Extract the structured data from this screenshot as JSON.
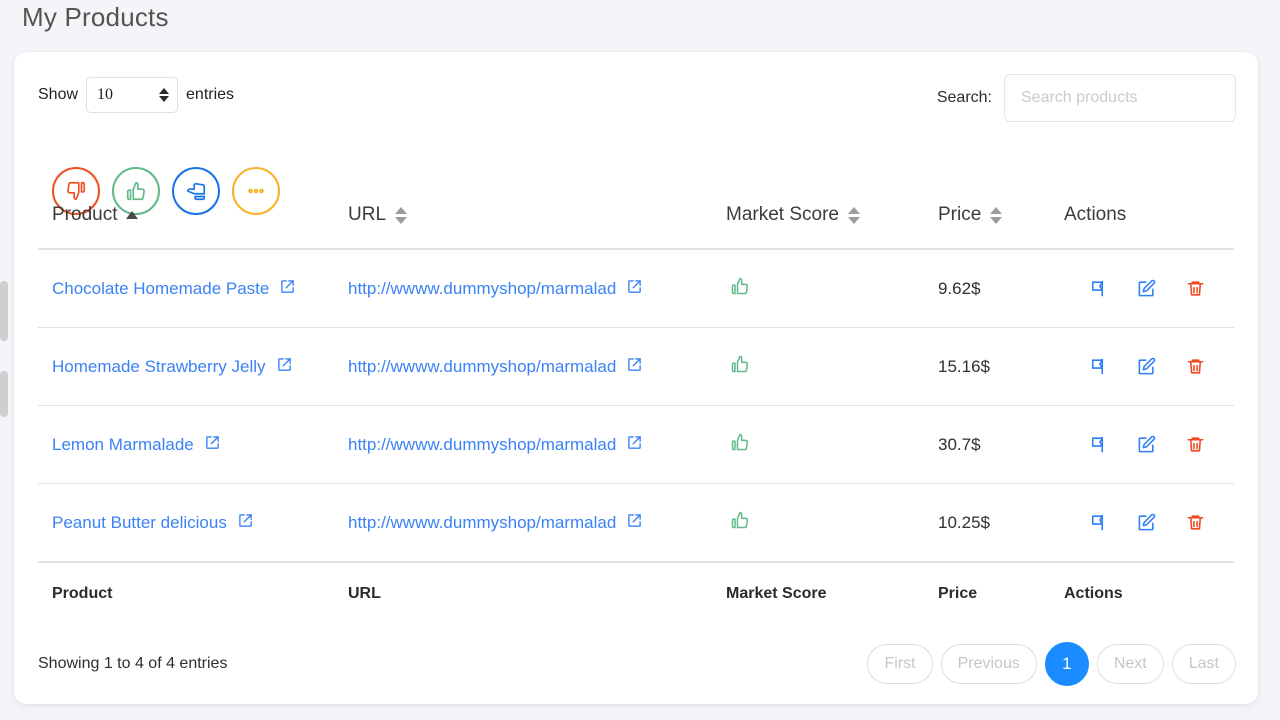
{
  "page": {
    "title": "My Products"
  },
  "colors": {
    "accent_blue": "#1a8cff",
    "link_blue": "#3b82f6",
    "danger_red": "#f0491f",
    "success_green": "#61b98a",
    "warning_yellow": "#f5b324",
    "page_background": "#f4f5f9",
    "card_background": "#ffffff"
  },
  "toolbar": {
    "show_label": "Show",
    "entries_label": "entries",
    "length_value": "10",
    "search_label": "Search:",
    "search_value": "",
    "search_placeholder": "Search products",
    "round_buttons": [
      {
        "name": "thumbs-down-button",
        "icon": "thumbs-down-icon",
        "color": "#f04e23"
      },
      {
        "name": "thumbs-up-button",
        "icon": "thumbs-up-icon",
        "color": "#61b98a"
      },
      {
        "name": "thumbs-right-button",
        "icon": "thumbs-right-icon",
        "color": "#1a73e8"
      },
      {
        "name": "more-options-button",
        "icon": "ellipsis-icon",
        "color": "#f5b324"
      }
    ]
  },
  "table": {
    "headers": [
      {
        "label": "Product",
        "sort": "asc"
      },
      {
        "label": "URL",
        "sort": "none"
      },
      {
        "label": "Market Score",
        "sort": "none"
      },
      {
        "label": "Price",
        "sort": "none"
      },
      {
        "label": "Actions",
        "sort": null
      }
    ],
    "footer_headers": [
      "Product",
      "URL",
      "Market Score",
      "Price",
      "Actions"
    ],
    "rows": [
      {
        "product": "Chocolate Homemade Paste",
        "url": "http://wwww.dummyshop/marmalad",
        "score_icon": "thumbs-up-icon",
        "price": "9.62$"
      },
      {
        "product": "Homemade Strawberry Jelly",
        "url": "http://wwww.dummyshop/marmalad",
        "score_icon": "thumbs-up-icon",
        "price": "15.16$"
      },
      {
        "product": "Lemon Marmalade",
        "url": "http://wwww.dummyshop/marmalad",
        "score_icon": "thumbs-up-icon",
        "price": "30.7$"
      },
      {
        "product": "Peanut Butter delicious",
        "url": "http://wwww.dummyshop/marmalad",
        "score_icon": "thumbs-up-icon",
        "price": "10.25$"
      }
    ],
    "row_actions": [
      "flag-icon",
      "edit-icon",
      "delete-icon"
    ]
  },
  "footer": {
    "info": "Showing 1 to 4 of 4 entries",
    "pagination": [
      {
        "label": "First",
        "active": false
      },
      {
        "label": "Previous",
        "active": false
      },
      {
        "label": "1",
        "active": true
      },
      {
        "label": "Next",
        "active": false
      },
      {
        "label": "Last",
        "active": false
      }
    ]
  }
}
